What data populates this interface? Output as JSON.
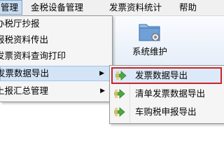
{
  "menubar": {
    "items": [
      "管理",
      "金税设备管理",
      "发票资料统计",
      "帮助"
    ]
  },
  "toolbar": {
    "ghost_label": "理",
    "system_maintenance": "系统维护"
  },
  "dropdown": {
    "items": [
      {
        "label": "办税厅抄报"
      },
      {
        "label": "报税资料传出"
      },
      {
        "label": "发票资料查询打印"
      },
      {
        "label": "发票数据导出"
      },
      {
        "label": "上报汇总管理"
      }
    ]
  },
  "submenu": {
    "items": [
      {
        "label": "发票数据导出"
      },
      {
        "label": "清单发票数据导出"
      },
      {
        "label": "车购税申报导出"
      }
    ]
  },
  "colors": {
    "highlight_border": "#c9242b",
    "highlight_fill": "#dbe9f8",
    "menu_bg": "#f5f5f5",
    "icon_green": "#4caa3c"
  }
}
